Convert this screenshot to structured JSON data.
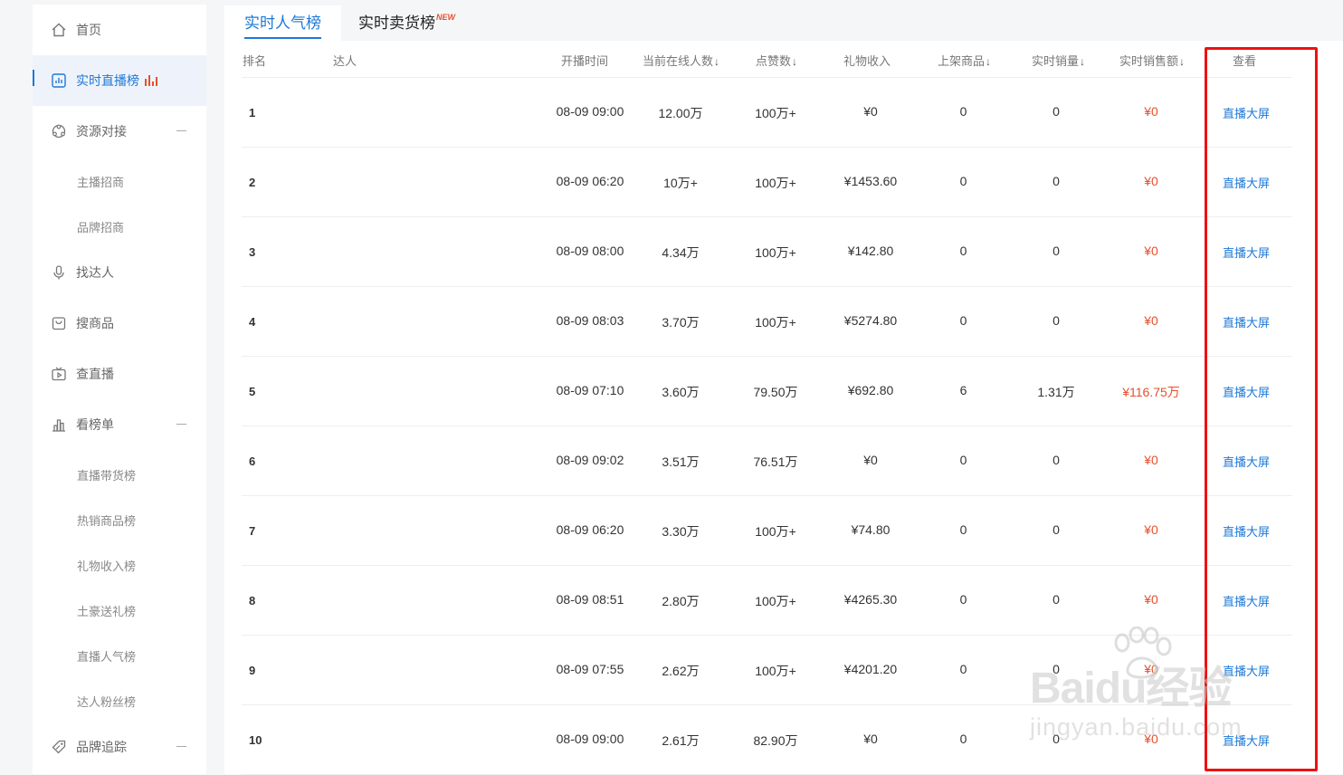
{
  "sidebar": {
    "items": [
      {
        "label": "首页",
        "icon": "home-icon"
      },
      {
        "label": "实时直播榜",
        "icon": "chart-icon",
        "active": true
      },
      {
        "label": "资源对接",
        "icon": "resource-icon",
        "expanded": true
      },
      {
        "label": "找达人",
        "icon": "microphone-icon"
      },
      {
        "label": "搜商品",
        "icon": "bag-icon"
      },
      {
        "label": "查直播",
        "icon": "tv-icon"
      },
      {
        "label": "看榜单",
        "icon": "bar-chart-icon",
        "expanded": true
      },
      {
        "label": "品牌追踪",
        "icon": "tag-icon",
        "expanded": true
      }
    ],
    "sub_resource": [
      "主播招商",
      "品牌招商"
    ],
    "sub_rank": [
      "直播带货榜",
      "热销商品榜",
      "礼物收入榜",
      "土豪送礼榜",
      "直播人气榜",
      "达人粉丝榜"
    ]
  },
  "tabs": {
    "active": "实时人气榜",
    "inactive": "实时卖货榜",
    "new_badge": "NEW"
  },
  "table": {
    "headers": {
      "rank": "排名",
      "talent": "达人",
      "time": "开播时间",
      "online": "当前在线人数",
      "likes": "点赞数",
      "gift": "礼物收入",
      "onshelf": "上架商品",
      "sales": "实时销量",
      "amount": "实时销售额",
      "view": "查看"
    },
    "sort_glyph": "↓",
    "rows": [
      {
        "rank": "1",
        "time": "08-09 09:00",
        "online": "12.00万",
        "likes": "100万+",
        "gift": "¥0",
        "onshelf": "0",
        "sales": "0",
        "amount": "¥0",
        "view": "直播大屏"
      },
      {
        "rank": "2",
        "time": "08-09 06:20",
        "online": "10万+",
        "likes": "100万+",
        "gift": "¥1453.60",
        "onshelf": "0",
        "sales": "0",
        "amount": "¥0",
        "view": "直播大屏"
      },
      {
        "rank": "3",
        "time": "08-09 08:00",
        "online": "4.34万",
        "likes": "100万+",
        "gift": "¥142.80",
        "onshelf": "0",
        "sales": "0",
        "amount": "¥0",
        "view": "直播大屏"
      },
      {
        "rank": "4",
        "time": "08-09 08:03",
        "online": "3.70万",
        "likes": "100万+",
        "gift": "¥5274.80",
        "onshelf": "0",
        "sales": "0",
        "amount": "¥0",
        "view": "直播大屏"
      },
      {
        "rank": "5",
        "time": "08-09 07:10",
        "online": "3.60万",
        "likes": "79.50万",
        "gift": "¥692.80",
        "onshelf": "6",
        "sales": "1.31万",
        "amount": "¥116.75万",
        "view": "直播大屏"
      },
      {
        "rank": "6",
        "time": "08-09 09:02",
        "online": "3.51万",
        "likes": "76.51万",
        "gift": "¥0",
        "onshelf": "0",
        "sales": "0",
        "amount": "¥0",
        "view": "直播大屏"
      },
      {
        "rank": "7",
        "time": "08-09 06:20",
        "online": "3.30万",
        "likes": "100万+",
        "gift": "¥74.80",
        "onshelf": "0",
        "sales": "0",
        "amount": "¥0",
        "view": "直播大屏"
      },
      {
        "rank": "8",
        "time": "08-09 08:51",
        "online": "2.80万",
        "likes": "100万+",
        "gift": "¥4265.30",
        "onshelf": "0",
        "sales": "0",
        "amount": "¥0",
        "view": "直播大屏"
      },
      {
        "rank": "9",
        "time": "08-09 07:55",
        "online": "2.62万",
        "likes": "100万+",
        "gift": "¥4201.20",
        "onshelf": "0",
        "sales": "0",
        "amount": "¥0",
        "view": "直播大屏"
      },
      {
        "rank": "10",
        "time": "08-09 09:00",
        "online": "2.61万",
        "likes": "82.90万",
        "gift": "¥0",
        "onshelf": "0",
        "sales": "0",
        "amount": "¥0",
        "view": "直播大屏"
      }
    ]
  },
  "watermark": {
    "line1": "Baidu经验",
    "line2": "jingyan.baidu.com"
  },
  "colors": {
    "accent": "#1e78d6",
    "money": "#e6502c",
    "highlight": "#ee1111"
  }
}
